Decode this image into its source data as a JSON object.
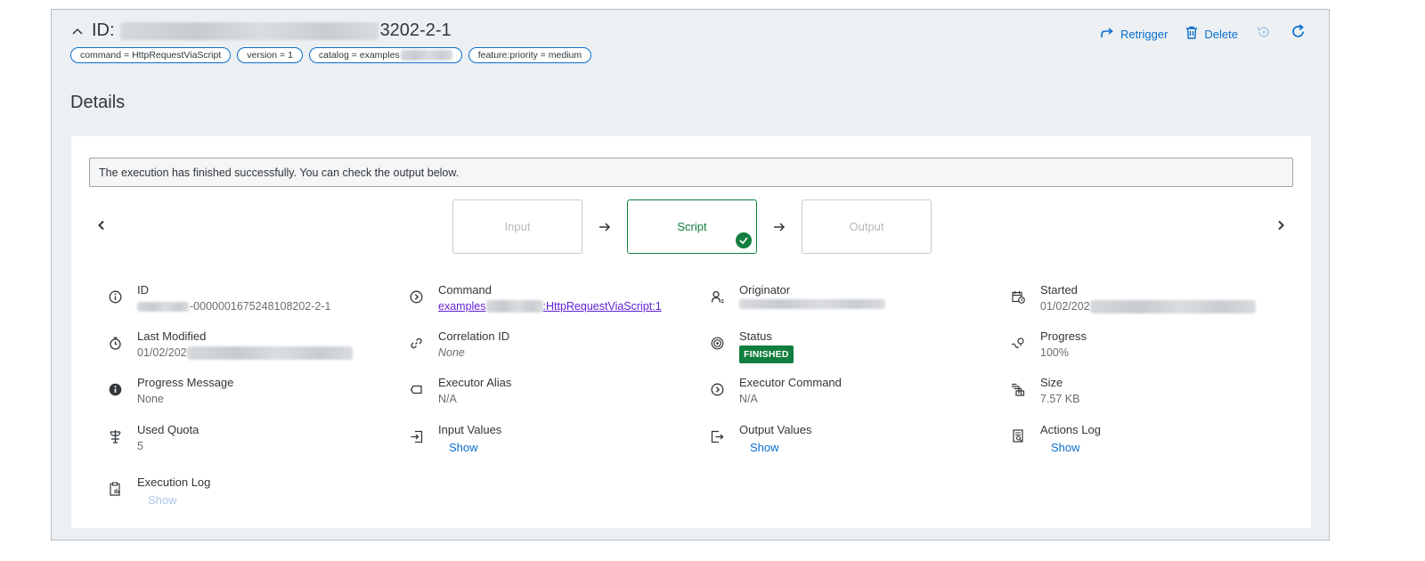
{
  "header": {
    "title_prefix": "ID:",
    "title_suffix": "3202-2-1",
    "tags": [
      {
        "text": "command = HttpRequestViaScript"
      },
      {
        "text": "version = 1"
      },
      {
        "text": "catalog = examples"
      },
      {
        "text": "feature:priority = medium"
      }
    ],
    "actions": {
      "retrigger": "Retrigger",
      "delete": "Delete"
    }
  },
  "section": {
    "title": "Details"
  },
  "message": "The execution has finished successfully. You can check the output below.",
  "steps": [
    {
      "label": "Input",
      "state": "inactive"
    },
    {
      "label": "Script",
      "state": "done"
    },
    {
      "label": "Output",
      "state": "inactive"
    }
  ],
  "fields": {
    "id": {
      "label": "ID",
      "value": "-0000001675248108202-2-1"
    },
    "command": {
      "label": "Command",
      "value_prefix": "examples",
      "value_suffix": ":HttpRequestViaScript:1"
    },
    "originator": {
      "label": "Originator"
    },
    "started": {
      "label": "Started",
      "value": "01/02/202"
    },
    "last_modified": {
      "label": "Last Modified",
      "value": "01/02/202"
    },
    "correlation_id": {
      "label": "Correlation ID",
      "value": "None"
    },
    "status": {
      "label": "Status",
      "value": "FINISHED"
    },
    "progress": {
      "label": "Progress",
      "value": "100%"
    },
    "progress_message": {
      "label": "Progress Message",
      "value": "None"
    },
    "executor_alias": {
      "label": "Executor Alias",
      "value": "N/A"
    },
    "executor_command": {
      "label": "Executor Command",
      "value": "N/A"
    },
    "size": {
      "label": "Size",
      "value": "7.57 KB"
    },
    "used_quota": {
      "label": "Used Quota",
      "value": "5"
    },
    "input_values": {
      "label": "Input Values",
      "link": "Show"
    },
    "output_values": {
      "label": "Output Values",
      "link": "Show"
    },
    "actions_log": {
      "label": "Actions Log",
      "link": "Show"
    },
    "execution_log": {
      "label": "Execution Log",
      "link": "Show"
    }
  },
  "colors": {
    "accent": "#0a6ed1",
    "success": "#107e3e",
    "link_visited": "#5e1fd6"
  }
}
